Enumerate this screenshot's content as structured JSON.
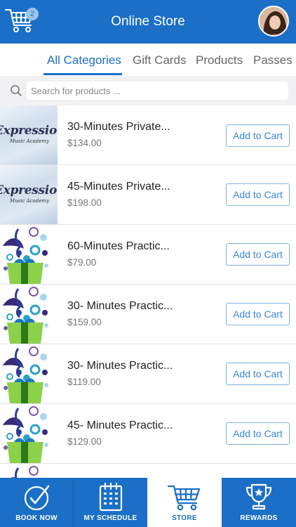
{
  "header": {
    "title": "Online Store",
    "cart_count": "2"
  },
  "tabs": [
    {
      "label": "All Categories",
      "active": true
    },
    {
      "label": "Gift Cards",
      "active": false
    },
    {
      "label": "Products",
      "active": false
    },
    {
      "label": "Passes &",
      "active": false
    }
  ],
  "search": {
    "placeholder": "Search for products ...",
    "value": ""
  },
  "products": [
    {
      "name": "30-Minutes Private...",
      "price": "$134.00",
      "button": "Add to Cart",
      "thumbnail": "expressions-logo"
    },
    {
      "name": "45-Minutes Private...",
      "price": "$198.00",
      "button": "Add to Cart",
      "thumbnail": "expressions-logo"
    },
    {
      "name": "60-Minutes Practic...",
      "price": "$79.00",
      "button": "Add to Cart",
      "thumbnail": "music-gift-box"
    },
    {
      "name": "30- Minutes Practic...",
      "price": "$159.00",
      "button": "Add to Cart",
      "thumbnail": "music-gift-box"
    },
    {
      "name": "30- Minutes Practic...",
      "price": "$119.00",
      "button": "Add to Cart",
      "thumbnail": "music-gift-box"
    },
    {
      "name": "45- Minutes Practic...",
      "price": "$129.00",
      "button": "Add to Cart",
      "thumbnail": "music-gift-box"
    }
  ],
  "thumbnail_text": {
    "logo_title": "Expressions",
    "logo_subtitle": "Music Academy"
  },
  "bottom_nav": [
    {
      "label": "BOOK NOW",
      "icon": "checkmark-circle-icon",
      "active": false
    },
    {
      "label": "MY SCHEDULE",
      "icon": "calendar-icon",
      "active": false
    },
    {
      "label": "STORE",
      "icon": "cart-icon",
      "active": true
    },
    {
      "label": "REWARDS",
      "icon": "trophy-icon",
      "active": false
    }
  ],
  "colors": {
    "brand_blue": "#1b6fc7",
    "button_text": "#3a86d4"
  }
}
